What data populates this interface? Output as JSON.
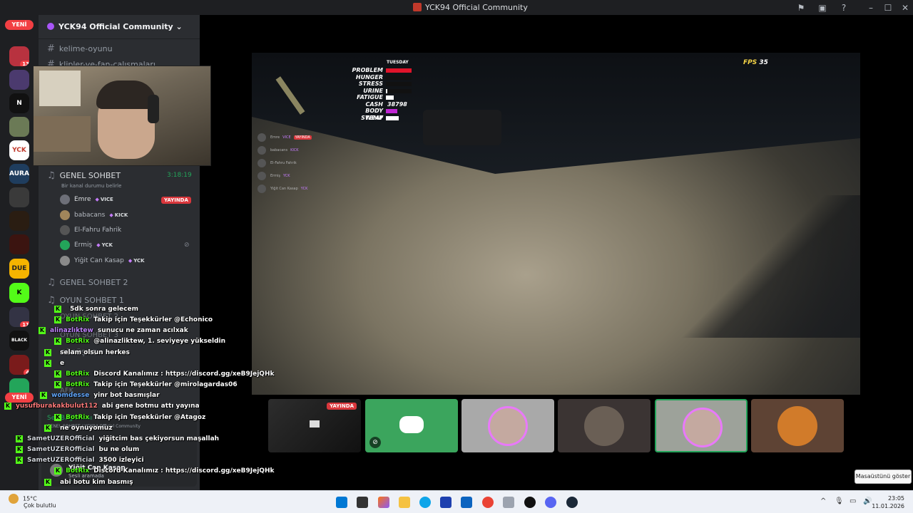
{
  "window": {
    "title": "YCK94 Official Community"
  },
  "servers": {
    "new_label_top": "YENİ",
    "new_label_bottom": "YENİ",
    "badges": [
      "13",
      "4",
      "11",
      "4"
    ]
  },
  "guild": {
    "name": "YCK94 Official Community"
  },
  "channels": {
    "kelime": "kelime-oyunu",
    "klipler": "klipler-ve-fan-çalışmaları",
    "genel_sohbet": "GENEL SOHBET",
    "genel_sohbet_timer": "3:18:19",
    "status_hint": "Bir kanal durumu belirle",
    "genel_sohbet_2": "GENEL SOHBET 2",
    "oyun_sohbet_1": "OYUN SOHBET 1",
    "oyun_sohbet_2": "OYUN SOHBET 2",
    "oyun_sohbet_3": "OYUN SOHBET 3",
    "gorusme": "GÖRÜŞME",
    "afk": "AFK"
  },
  "voice_users": [
    {
      "name": "Emre",
      "tag": "VICE",
      "live": "YAYINDA"
    },
    {
      "name": "babacans",
      "tag": "KICK"
    },
    {
      "name": "El-Fahru Fahrik",
      "tag": ""
    },
    {
      "name": "Ermiş",
      "tag": "YCK"
    },
    {
      "name": "Yiğit Can Kasap",
      "tag": "YCK"
    }
  ],
  "game_hud": {
    "day": "TUESDAY",
    "stats": [
      {
        "label": "PROBLEM",
        "level": 1.0,
        "color": "#e0142a"
      },
      {
        "label": "HUNGER",
        "level": 0.0,
        "color": "#ffffff"
      },
      {
        "label": "STRESS",
        "level": 0.0,
        "color": "#ffffff"
      },
      {
        "label": "URINE",
        "level": 0.05,
        "color": "#ffffff"
      },
      {
        "label": "FATIGUE",
        "level": 0.3,
        "color": "#ffffff"
      },
      {
        "label": "CASH",
        "value": "38798"
      },
      {
        "label": "BODY TEMP",
        "level": 0.45,
        "color": "#c026d3"
      },
      {
        "label": "SWEAT",
        "level": 0.5,
        "color": "#ffffff"
      }
    ],
    "fps_label": "FPS",
    "fps_value": "35"
  },
  "game_overlay_voice": [
    {
      "name": "Emre",
      "tag": "VICE",
      "live": "YAYINDA"
    },
    {
      "name": "babacans",
      "tag": "KICK"
    },
    {
      "name": "El-Fahru Fahrik",
      "tag": ""
    },
    {
      "name": "Ermiş",
      "tag": "YCK"
    },
    {
      "name": "Yiğit Can Kasap",
      "tag": "YCK"
    }
  ],
  "stream_tiles": {
    "live_label": "YAYINDA"
  },
  "voice_panel": {
    "label": "Ses Bağlantısı",
    "sub": "GENEL SOHBET / YCK94 Official Community",
    "user": "Yiğit Can Kasap",
    "user_status": "Sesli aramada"
  },
  "chat": [
    {
      "user": "",
      "msg": "5dk sonra gelecem",
      "color": "#ff3b3b"
    },
    {
      "user": "BotRix",
      "msg": "Takip için Teşekkürler @Echonico",
      "color": "#53fc18"
    },
    {
      "user": "alinazlıktew",
      "msg": "sunucu ne zaman acılxak",
      "color": "#c084fc"
    },
    {
      "user": "BotRix",
      "msg": "@alinazliktew, 1. seviyeye yükseldin",
      "color": "#53fc18"
    },
    {
      "user": "",
      "msg": "selam olsun herkes",
      "color": "#ff3b3b"
    },
    {
      "user": "",
      "msg": "e",
      "color": "#ff3b3b"
    },
    {
      "user": "BotRix",
      "msg": "Discord Kanalımız : https://discord.gg/xeB9JejQHk",
      "color": "#53fc18"
    },
    {
      "user": "BotRix",
      "msg": "Takip için Teşekkürler @mirolagardas06",
      "color": "#53fc18"
    },
    {
      "user": "womdesse",
      "msg": "yinr bot basmışlar",
      "color": "#60a5fa"
    },
    {
      "user": "yusufburakakbulut112",
      "msg": "abi gene botmu attı yayına",
      "color": "#ff7b7b"
    },
    {
      "user": "BotRix",
      "msg": "Takip için Teşekkürler @Atagoz",
      "color": "#53fc18"
    },
    {
      "user": "",
      "msg": "ne oynuyomuz",
      "color": "#ff3b3b"
    },
    {
      "user": "SametUZEROfficial",
      "msg": "yiğitcim bas çekiyorsun maşallah",
      "color": "#d1d5db"
    },
    {
      "user": "SametUZEROfficial",
      "msg": "bu ne olum",
      "color": "#d1d5db"
    },
    {
      "user": "SametUZEROfficial",
      "msg": "3500 izleyici",
      "color": "#d1d5db"
    },
    {
      "user": "BotRix",
      "msg": "Discord Kanalımız : https://discord.gg/xeB9JejQHk",
      "color": "#53fc18"
    },
    {
      "user": "",
      "msg": "abi botu kim basmış",
      "color": "#ff3b3b"
    }
  ],
  "taskbar": {
    "temp": "15°C",
    "weather": "Çok bulutlu",
    "time": "23:05",
    "date": "11.01.2026",
    "show_desktop": "Masaüstünü göster"
  }
}
